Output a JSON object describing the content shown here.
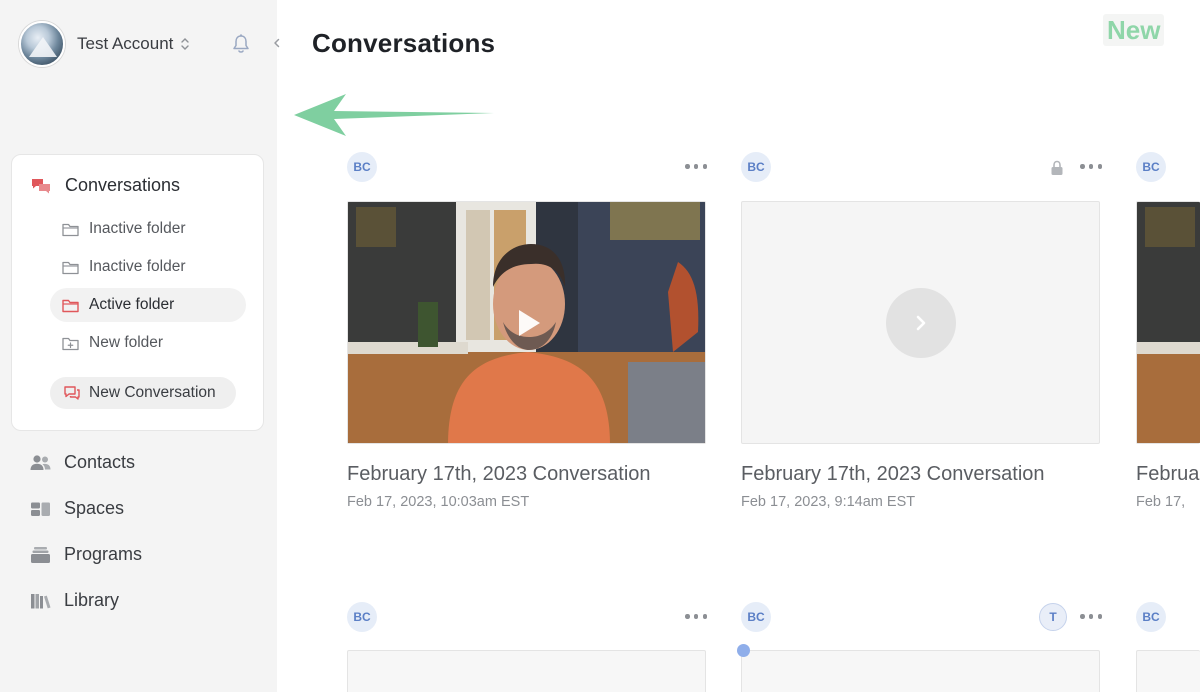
{
  "account": {
    "name": "Test Account"
  },
  "sidebar": {
    "section_title": "Conversations",
    "folders": [
      {
        "label": "Inactive folder",
        "state": "inactive"
      },
      {
        "label": "Inactive folder",
        "state": "inactive"
      },
      {
        "label": "Active folder",
        "state": "active"
      },
      {
        "label": "New folder",
        "state": "new"
      }
    ],
    "new_conversation": "New Conversation",
    "nav": [
      {
        "label": "Contacts",
        "icon": "contacts-icon"
      },
      {
        "label": "Spaces",
        "icon": "spaces-icon"
      },
      {
        "label": "Programs",
        "icon": "programs-icon"
      },
      {
        "label": "Library",
        "icon": "library-icon"
      }
    ]
  },
  "main": {
    "title": "Conversations",
    "new_badge": "New",
    "cards": [
      {
        "initials": "BC",
        "title": "February 17th, 2023 Conversation",
        "date": "Feb 17, 2023, 10:03am EST",
        "thumbnail": "video-frame"
      },
      {
        "initials": "BC",
        "title": "February 17th, 2023 Conversation",
        "date": "Feb 17, 2023, 9:14am EST",
        "thumbnail": "empty-with-play",
        "locked": true
      },
      {
        "initials": "BC",
        "title": "Februa",
        "date": "Feb 17,",
        "thumbnail": "video-frame-partial"
      },
      {
        "initials": "BC",
        "thumbnail": "empty"
      },
      {
        "initials": "BC",
        "participant": "T",
        "thumbnail": "empty"
      },
      {
        "initials": "BC",
        "thumbnail": "empty"
      }
    ]
  },
  "colors": {
    "accent_red": "#e0575b",
    "badge_blue": "#5b7fc6",
    "arrow_green": "#7fcfa0",
    "sidebar_bg": "#f4f4f4"
  }
}
